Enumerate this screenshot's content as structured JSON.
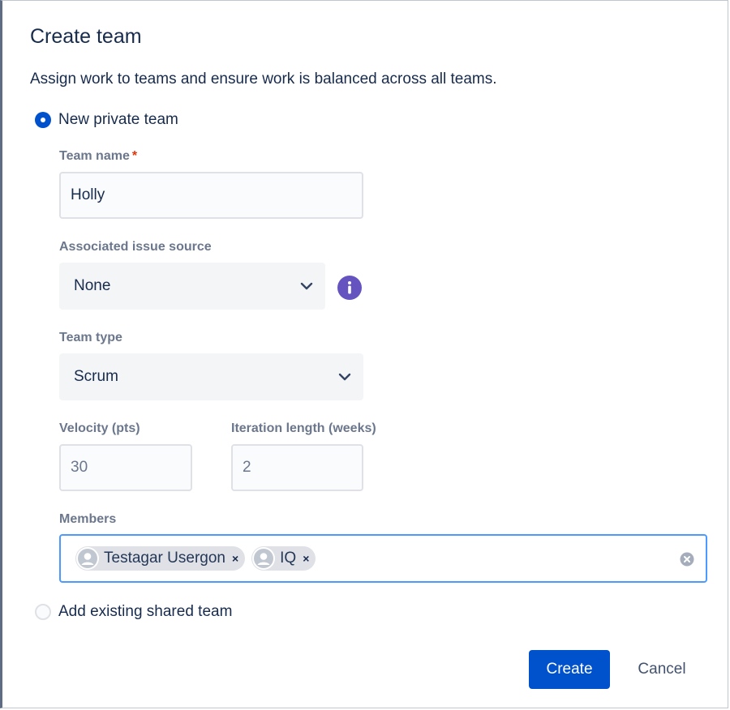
{
  "dialog": {
    "title": "Create team",
    "description": "Assign work to teams and ensure work is balanced across all teams."
  },
  "options": {
    "new_private_team": {
      "label": "New private team",
      "selected": true
    },
    "add_existing_shared_team": {
      "label": "Add existing shared team",
      "selected": false
    }
  },
  "form": {
    "team_name": {
      "label": "Team name",
      "required_marker": "*",
      "value": "Holly"
    },
    "issue_source": {
      "label": "Associated issue source",
      "value": "None",
      "info_icon": "info-icon"
    },
    "team_type": {
      "label": "Team type",
      "value": "Scrum"
    },
    "velocity": {
      "label": "Velocity (pts)",
      "value": "30"
    },
    "iteration_length": {
      "label": "Iteration length (weeks)",
      "value": "2"
    },
    "members": {
      "label": "Members",
      "items": [
        {
          "name": "Testagar Usergon",
          "remove": "×"
        },
        {
          "name": "IQ",
          "remove": "×"
        }
      ]
    }
  },
  "actions": {
    "create_label": "Create",
    "cancel_label": "Cancel"
  },
  "colors": {
    "primary": "#0052cc",
    "info": "#6554c0",
    "focus": "#4c9aff",
    "required": "#de350b"
  }
}
